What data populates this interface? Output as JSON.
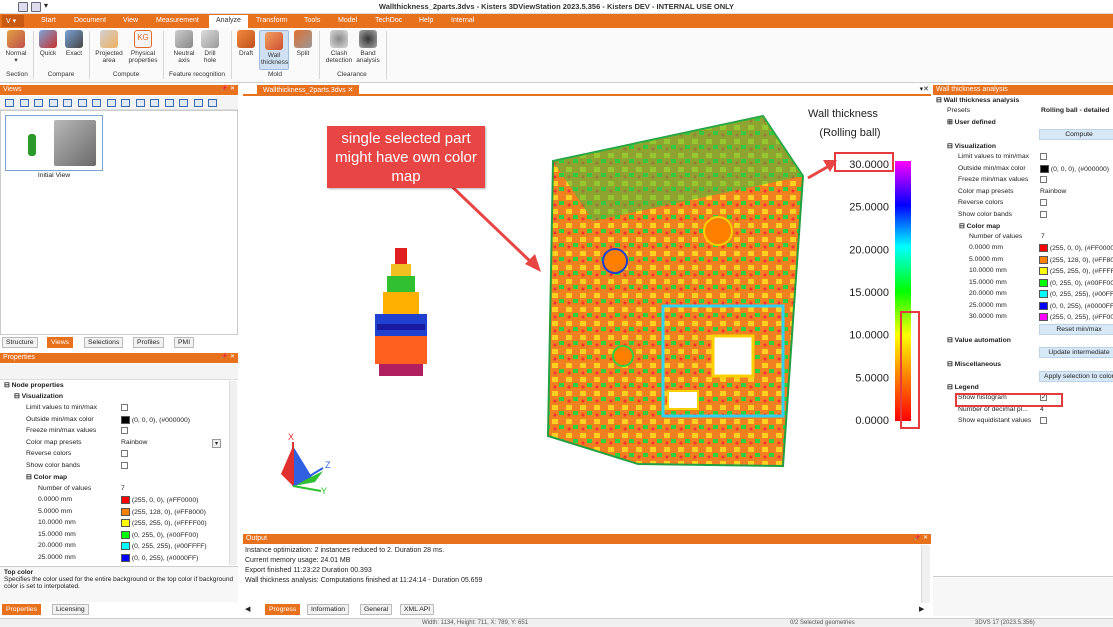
{
  "titlebar": {
    "title": "Wallthickness_2parts.3dvs - Kisters 3DViewStation 2023.5.356 - Kisters DEV - INTERNAL USE ONLY"
  },
  "menu": {
    "app_button": "V",
    "items": [
      "Start",
      "Document",
      "View",
      "Measurement",
      "Analyze",
      "Transform",
      "Tools",
      "Model",
      "TechDoc",
      "Help",
      "Internal"
    ],
    "active": "Analyze"
  },
  "ribbon": {
    "buttons": [
      {
        "label": "Normal",
        "icon": "section-normal-icon"
      },
      {
        "label": "Quick",
        "icon": "compare-quick-icon"
      },
      {
        "label": "Exact",
        "icon": "compare-exact-icon"
      },
      {
        "label": "Projected area",
        "icon": "projected-area-icon"
      },
      {
        "label": "Physical properties",
        "icon": "physical-properties-icon"
      },
      {
        "label": "Neutral axis",
        "icon": "neutral-axis-icon"
      },
      {
        "label": "Drill hole",
        "icon": "drill-hole-icon"
      },
      {
        "label": "Draft",
        "icon": "draft-icon"
      },
      {
        "label": "Wall thickness",
        "icon": "wall-thickness-icon"
      },
      {
        "label": "Split",
        "icon": "split-icon"
      },
      {
        "label": "Clash detection",
        "icon": "clash-detection-icon"
      },
      {
        "label": "Band analysis",
        "icon": "band-analysis-icon"
      }
    ],
    "groups": [
      "Section",
      "Compare",
      "Compute",
      "Feature recognition",
      "Mold",
      "Clearance"
    ]
  },
  "views_panel": {
    "title": "Views",
    "thumbnail_label": "Initial View",
    "tabs": [
      "Structure",
      "Views",
      "Selections",
      "Profiles",
      "PMI"
    ],
    "active_tab": "Views"
  },
  "properties_panel": {
    "title": "Properties",
    "section_node": "Node properties",
    "section_vis": "Visualization",
    "rows": [
      {
        "label": "Limit values to min/max",
        "type": "check",
        "value": ""
      },
      {
        "label": "Outside min/max color",
        "type": "color",
        "color": "#000000",
        "value": "(0, 0, 0), (#000000)"
      },
      {
        "label": "Freeze min/max values",
        "type": "check",
        "value": ""
      },
      {
        "label": "Color map presets",
        "type": "select",
        "value": "Rainbow"
      },
      {
        "label": "Reverse colors",
        "type": "check",
        "value": ""
      },
      {
        "label": "Show color bands",
        "type": "check",
        "value": ""
      }
    ],
    "color_map_label": "Color map",
    "num_values_label": "Number of values",
    "num_values": "7",
    "color_map": [
      {
        "label": "0.0000 mm",
        "color": "#FF0000",
        "value": "(255, 0, 0), (#FF0000)"
      },
      {
        "label": "5.0000 mm",
        "color": "#FF8000",
        "value": "(255, 128, 0), (#FF8000)"
      },
      {
        "label": "10.0000 mm",
        "color": "#FFFF00",
        "value": "(255, 255, 0), (#FFFF00)"
      },
      {
        "label": "15.0000 mm",
        "color": "#00FF00",
        "value": "(0, 255, 0), (#00FF00)"
      },
      {
        "label": "20.0000 mm",
        "color": "#00FFFF",
        "value": "(0, 255, 255), (#00FFFF)"
      },
      {
        "label": "25.0000 mm",
        "color": "#0000FF",
        "value": "(0, 0, 255), (#0000FF)"
      }
    ],
    "help_title": "Top color",
    "help_text": "Specifies the color used for the entire background or the top color if background color is set to interpolated.",
    "bottom_tabs": [
      "Properties",
      "Licensing"
    ]
  },
  "document_tab": {
    "label": "Wallthickness_2parts.3dvs"
  },
  "viewport": {
    "legend_title_1": "Wall thickness",
    "legend_title_2": "(Rolling ball)",
    "legend_values": [
      "30.0000",
      "25.0000",
      "20.0000",
      "15.0000",
      "10.0000",
      "5.0000",
      "0.0000"
    ],
    "callout": "single selected part might have own color map",
    "axes": {
      "x": "X",
      "y": "Y",
      "z": "Z"
    }
  },
  "output_panel": {
    "title": "Output",
    "lines": [
      "Instance optimization: 2 instances reduced to 2. Duration 28 ms.",
      "Current memory usage: 24.01 MB",
      "Export finished 11:23:22 Duration 00.393",
      "Wall thickness analysis: Computations finished at 11:24:14  - Duration 05.659"
    ],
    "tabs": [
      "Progress",
      "Information",
      "General",
      "XML API"
    ]
  },
  "wta_panel": {
    "title": "Wall thickness analysis",
    "header": "Wall thickness analysis",
    "presets_label": "Presets",
    "presets_value": "Rolling ball - detailed",
    "user_defined": "User defined",
    "compute_btn": "Compute",
    "visualization": "Visualization",
    "vis_rows": [
      {
        "label": "Limit values to min/max",
        "type": "check",
        "value": ""
      },
      {
        "label": "Outside min/max color",
        "type": "color",
        "color": "#000000",
        "value": "(0, 0, 0), (#000000)"
      },
      {
        "label": "Freeze min/max values",
        "type": "check",
        "value": ""
      },
      {
        "label": "Color map presets",
        "type": "text",
        "value": "Rainbow"
      },
      {
        "label": "Reverse colors",
        "type": "check",
        "value": ""
      },
      {
        "label": "Show color bands",
        "type": "check",
        "value": ""
      }
    ],
    "color_map_label": "Color map",
    "num_values_label": "Number of values",
    "num_values": "7",
    "color_map": [
      {
        "label": "0.0000 mm",
        "color": "#FF0000",
        "value": "(255, 0, 0), (#FF0000)"
      },
      {
        "label": "5.0000 mm",
        "color": "#FF8000",
        "value": "(255, 128, 0), (#FF8000)"
      },
      {
        "label": "10.0000 mm",
        "color": "#FFFF00",
        "value": "(255, 255, 0), (#FFFF00)"
      },
      {
        "label": "15.0000 mm",
        "color": "#00FF00",
        "value": "(0, 255, 0), (#00FF00)"
      },
      {
        "label": "20.0000 mm",
        "color": "#00FFFF",
        "value": "(0, 255, 255), (#00FFFF)"
      },
      {
        "label": "25.0000 mm",
        "color": "#0000FF",
        "value": "(0, 0, 255), (#0000FF)"
      },
      {
        "label": "30.0000 mm",
        "color": "#FF00FF",
        "value": "(255, 0, 255), (#FF00FF)"
      }
    ],
    "reset_btn": "Reset min/max",
    "value_automation": "Value automation",
    "update_btn": "Update intermediate",
    "misc": "Miscellaneous",
    "apply_btn": "Apply selection to color",
    "legend": "Legend",
    "legend_rows": [
      {
        "label": "Show histogram",
        "type": "check",
        "checked": true,
        "value": ""
      },
      {
        "label": "Number of decimal pl...",
        "type": "text",
        "value": "4"
      },
      {
        "label": "Show equidistant values",
        "type": "check",
        "checked": false,
        "value": ""
      }
    ]
  },
  "statusbar": {
    "dimensions": "Width: 1134, Height: 711, X: 789, Y: 651",
    "selected": "0/2 Selected geometries",
    "version": "3DVS 17 (2023.5.356)"
  }
}
